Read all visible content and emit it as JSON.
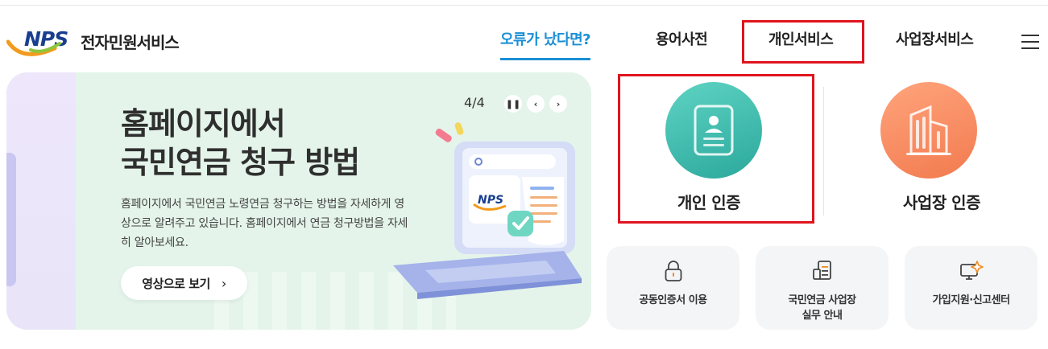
{
  "header": {
    "logo_mark": "NPS",
    "logo_text": "전자민원서비스",
    "nav": [
      {
        "label": "오류가 났다면?",
        "active": true
      },
      {
        "label": "용어사전",
        "active": false
      },
      {
        "label": "개인서비스",
        "active": false
      },
      {
        "label": "사업장서비스",
        "active": false
      }
    ],
    "menu_icon": "hamburger-menu-icon"
  },
  "banner": {
    "title_line1": "홈페이지에서",
    "title_line2": "국민연금 청구 방법",
    "description": "홈페이지에서 국민연금 노령연금 청구하는 방법을 자세하게 영상으로 알려주고 있습니다. 홈페이지에서 연금 청구방법을 자세히 알아보세요.",
    "button_label": "영상으로 보기",
    "pager": "4/4",
    "illustration_logo": "NPS",
    "controls": [
      "pause-icon",
      "chevron-left-icon",
      "chevron-right-icon"
    ]
  },
  "auth": {
    "personal_label": "개인 인증",
    "business_label": "사업장 인증",
    "personal_color": "#3bbcad",
    "business_color": "#f6895f"
  },
  "tiles": [
    {
      "label_lines": [
        "공동인증서 이용"
      ],
      "icon": "lock-icon"
    },
    {
      "label_lines": [
        "국민연금 사업장",
        "실무 안내"
      ],
      "icon": "document-icon"
    },
    {
      "label_lines": [
        "가입지원·신고센터"
      ],
      "icon": "monitor-spark-icon"
    }
  ],
  "colors": {
    "accent_blue": "#1a8fd6",
    "highlight_red": "#e0141e",
    "brand_navy": "#1a3f8f"
  }
}
